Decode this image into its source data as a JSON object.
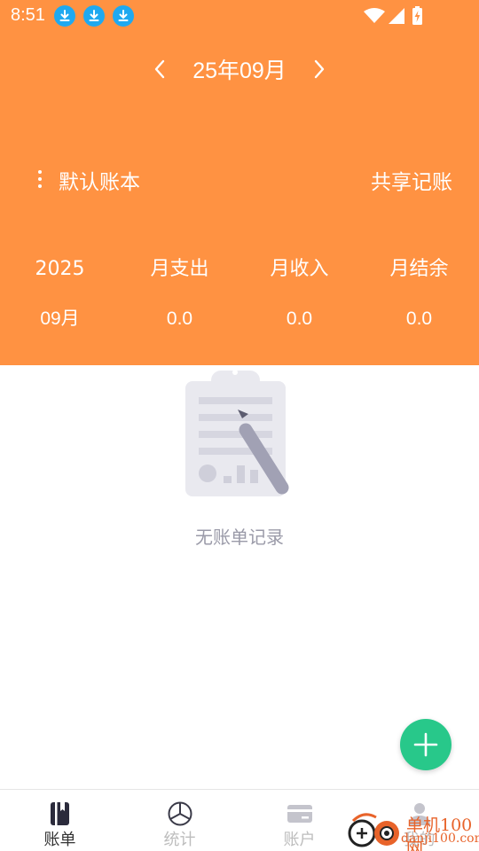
{
  "status_bar": {
    "time": "8:51"
  },
  "month_nav": {
    "label": "25年09月"
  },
  "book": {
    "name": "默认账本",
    "share_label": "共享记账"
  },
  "stats": {
    "headers": [
      "2025",
      "月支出",
      "月收入",
      "月结余"
    ],
    "values": [
      "09月",
      "0.0",
      "0.0",
      "0.0"
    ]
  },
  "empty": {
    "text": "无账单记录"
  },
  "tabs": [
    {
      "label": "账单",
      "icon": "book-icon",
      "active": true
    },
    {
      "label": "统计",
      "icon": "pie-chart-icon",
      "active": false
    },
    {
      "label": "账户",
      "icon": "card-icon",
      "active": false
    },
    {
      "label": "我的",
      "icon": "person-icon",
      "active": false
    }
  ],
  "watermark": {
    "text": "单机100网",
    "url": "danji100.com"
  },
  "colors": {
    "header": "#FF9242",
    "fab": "#28C88A",
    "download_badge": "#1FA9F0",
    "text_muted": "#9a9aa8"
  }
}
